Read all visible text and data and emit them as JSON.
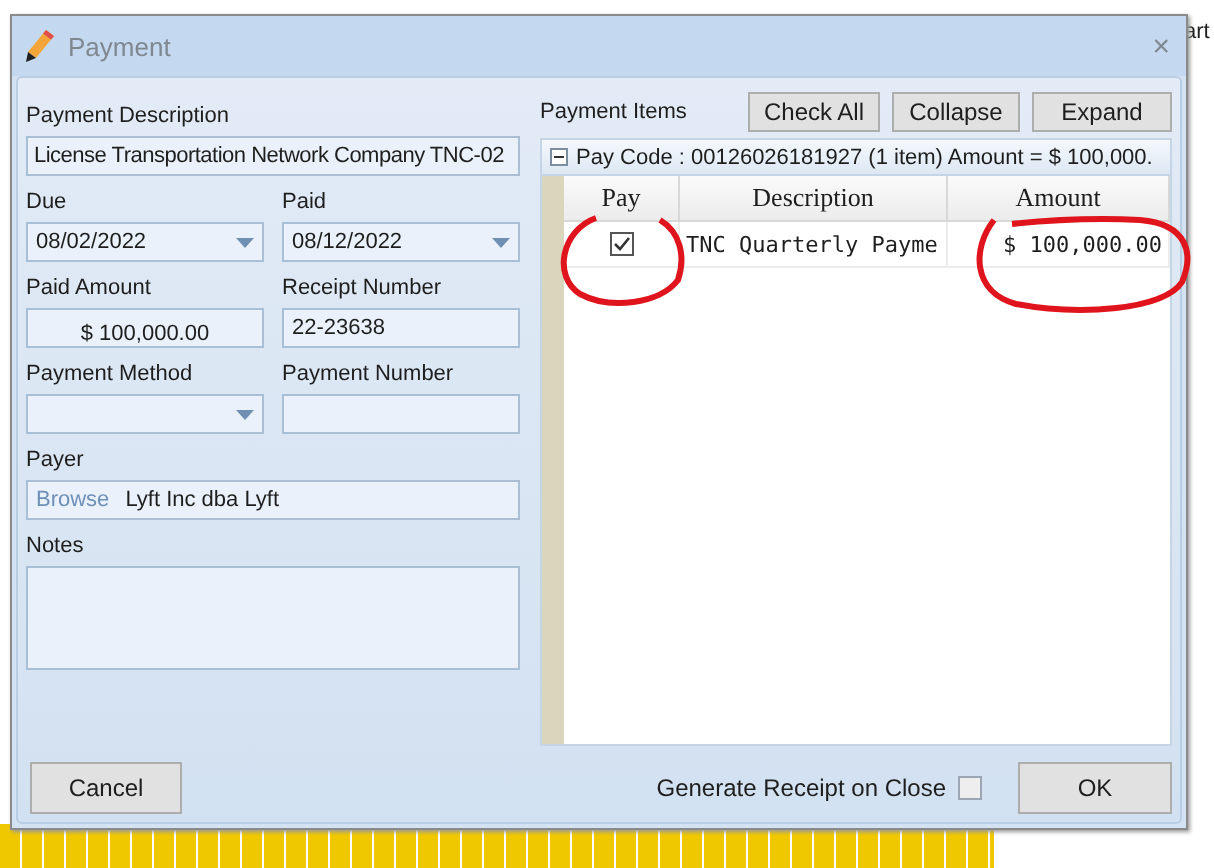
{
  "background": {
    "text": "art"
  },
  "window": {
    "title": "Payment",
    "close": "×"
  },
  "form": {
    "description": {
      "label": "Payment Description",
      "value": "License Transportation Network Company TNC-02"
    },
    "due": {
      "label": "Due",
      "value": "08/02/2022"
    },
    "paid": {
      "label": "Paid",
      "value": "08/12/2022"
    },
    "paid_amount": {
      "label": "Paid Amount",
      "value": "$ 100,000.00"
    },
    "receipt_number": {
      "label": "Receipt Number",
      "value": "22-23638"
    },
    "payment_method": {
      "label": "Payment Method"
    },
    "payment_number": {
      "label": "Payment Number"
    },
    "payer": {
      "label": "Payer",
      "link": "Browse",
      "value": "Lyft Inc dba Lyft"
    },
    "notes": {
      "label": "Notes"
    }
  },
  "payment_items": {
    "title": "Payment Items",
    "buttons": [
      "Check All",
      "Collapse",
      "Expand"
    ],
    "group": {
      "expanded": true,
      "text": "Pay Code : 00126026181927 (1 item) Amount = $ 100,000."
    },
    "columns": [
      "Pay",
      "Description",
      "Amount"
    ],
    "rows": [
      {
        "pay": true,
        "description": "TNC Quarterly Payme",
        "amount": "$ 100,000.00"
      }
    ]
  },
  "footer": {
    "cancel": "Cancel",
    "generate_receipt": {
      "label": "Generate Receipt on Close",
      "checked": false
    },
    "ok": "OK"
  }
}
